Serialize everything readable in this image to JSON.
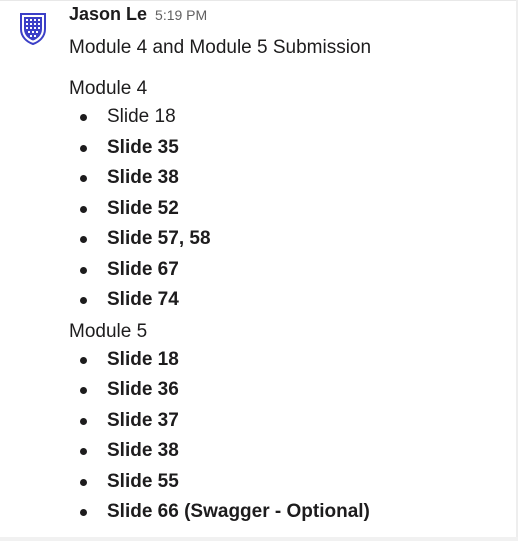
{
  "message": {
    "sender": "Jason Le",
    "timestamp": "5:19 PM",
    "avatar_icon": "shield-grid-icon",
    "avatar_color": "#3b3fc7",
    "subject": "Module 4 and Module 5 Submission",
    "sections": [
      {
        "title": "Module 4",
        "items": [
          "Slide 18",
          "Slide 35",
          "Slide 38",
          "Slide 52",
          "Slide 57, 58",
          "Slide 67",
          "Slide 74"
        ]
      },
      {
        "title": "Module 5",
        "items": [
          "Slide 18",
          "Slide 36",
          "Slide 37",
          "Slide 38",
          "Slide 55",
          "Slide 66 (Swagger - Optional)"
        ]
      }
    ]
  }
}
